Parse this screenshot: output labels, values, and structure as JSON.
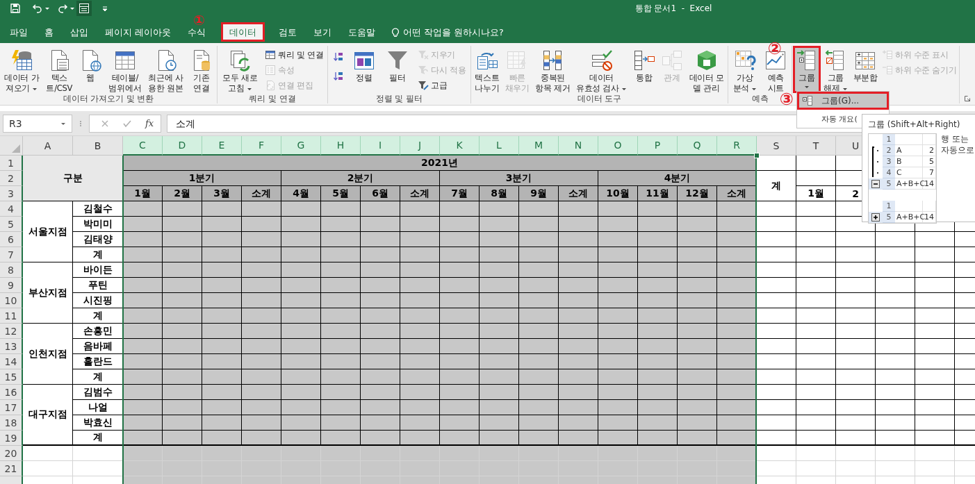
{
  "window": {
    "title": "통합 문서1  -  Excel"
  },
  "tabs": [
    {
      "label": "파일",
      "selected": false,
      "highlighted": false
    },
    {
      "label": "홈",
      "selected": false,
      "highlighted": false
    },
    {
      "label": "삽입",
      "selected": false,
      "highlighted": false
    },
    {
      "label": "페이지 레이아웃",
      "selected": false,
      "highlighted": false
    },
    {
      "label": "수식",
      "selected": false,
      "highlighted": false
    },
    {
      "label": "데이터",
      "selected": true,
      "highlighted": true
    },
    {
      "label": "검토",
      "selected": false,
      "highlighted": false
    },
    {
      "label": "보기",
      "selected": false,
      "highlighted": false
    },
    {
      "label": "도움말",
      "selected": false,
      "highlighted": false
    }
  ],
  "tell_me": "어떤 작업을 원하시나요?",
  "ribbon": [
    {
      "label": "데이터 가져오기 및 변환",
      "items": [
        {
          "kind": "large",
          "label": "데이터 가\n져오기",
          "dropdown": true,
          "disabled": false,
          "pressed": false,
          "highlighted": false
        },
        {
          "kind": "large",
          "label": "텍스\n트/CSV",
          "dropdown": false,
          "disabled": false,
          "pressed": false,
          "highlighted": false
        },
        {
          "kind": "large",
          "label": "웹",
          "dropdown": false,
          "disabled": false,
          "pressed": false,
          "highlighted": false
        },
        {
          "kind": "large",
          "label": "테이블/\n범위에서",
          "dropdown": false,
          "disabled": false,
          "pressed": false,
          "highlighted": false
        },
        {
          "kind": "large",
          "label": "최근에 사\n용한 원본",
          "dropdown": false,
          "disabled": false,
          "pressed": false,
          "highlighted": false
        },
        {
          "kind": "large",
          "label": "기존\n연결",
          "dropdown": false,
          "disabled": false,
          "pressed": false,
          "highlighted": false
        }
      ]
    },
    {
      "label": "쿼리 및 연결",
      "items": [
        {
          "kind": "large",
          "label": "모두 새로\n고침",
          "dropdown": true,
          "disabled": false,
          "pressed": false,
          "highlighted": false
        },
        {
          "kind": "stack",
          "items": [
            {
              "label": "쿼리 및 연결",
              "disabled": false
            },
            {
              "label": "속성",
              "disabled": true
            },
            {
              "label": "연결 편집",
              "disabled": true
            }
          ]
        }
      ]
    },
    {
      "label": "정렬 및 필터",
      "items": [
        {
          "kind": "stack",
          "items": [
            {
              "disabled": false
            },
            {
              "disabled": false
            }
          ]
        },
        {
          "kind": "large",
          "label": "정렬",
          "dropdown": false,
          "disabled": false,
          "pressed": false,
          "highlighted": false
        },
        {
          "kind": "large",
          "label": "필터",
          "dropdown": false,
          "disabled": false,
          "pressed": false,
          "highlighted": false
        },
        {
          "kind": "stack",
          "items": [
            {
              "label": "지우기",
              "disabled": true
            },
            {
              "label": "다시 적용",
              "disabled": true
            },
            {
              "label": "고급",
              "disabled": false
            }
          ]
        }
      ]
    },
    {
      "label": "데이터 도구",
      "items": [
        {
          "kind": "large",
          "label": "텍스트\n나누기",
          "dropdown": false,
          "disabled": false,
          "pressed": false,
          "highlighted": false
        },
        {
          "kind": "large",
          "label": "빠른\n채우기",
          "dropdown": false,
          "disabled": true,
          "pressed": false,
          "highlighted": false
        },
        {
          "kind": "large",
          "label": "중복된\n항목 제거",
          "dropdown": false,
          "disabled": false,
          "pressed": false,
          "highlighted": false
        },
        {
          "kind": "large",
          "label": "데이터\n유효성 검사",
          "dropdown": true,
          "disabled": false,
          "pressed": false,
          "highlighted": false
        },
        {
          "kind": "large",
          "label": "통합",
          "dropdown": false,
          "disabled": false,
          "pressed": false,
          "highlighted": false
        },
        {
          "kind": "large",
          "label": "관계",
          "dropdown": false,
          "disabled": true,
          "pressed": false,
          "highlighted": false
        },
        {
          "kind": "large",
          "label": "데이터 모\n델 관리",
          "dropdown": false,
          "disabled": false,
          "pressed": false,
          "highlighted": false
        }
      ]
    },
    {
      "label": "예측",
      "items": [
        {
          "kind": "large",
          "label": "가상\n분석",
          "dropdown": true,
          "disabled": false,
          "pressed": false,
          "highlighted": false
        },
        {
          "kind": "large",
          "label": "예측\n시트",
          "dropdown": false,
          "disabled": false,
          "pressed": false,
          "highlighted": false
        }
      ]
    },
    {
      "items": [
        {
          "kind": "large",
          "label": "그룹",
          "dropdown": true,
          "disabled": false,
          "pressed": true,
          "highlighted": true
        },
        {
          "kind": "large",
          "label": "그룹\n해제",
          "dropdown": true,
          "disabled": false,
          "pressed": false,
          "highlighted": false
        },
        {
          "kind": "large",
          "label": "부분합",
          "dropdown": false,
          "disabled": false,
          "pressed": false,
          "highlighted": false
        },
        {
          "kind": "stack",
          "items": [
            {
              "label": "하위 수준 표시",
              "disabled": true
            },
            {
              "label": "하위 수준 숨기기",
              "disabled": true
            }
          ]
        }
      ]
    }
  ],
  "menu": [
    {
      "label": "그룹(G)...",
      "selected": true,
      "highlighted": true
    },
    {
      "label": "자동 개요(",
      "selected": false,
      "highlighted": false
    }
  ],
  "tooltip": {
    "title": "그룹 (Shift+Alt+Right)",
    "examples": [
      {
        "expanded": true,
        "rows": [
          {
            "row": "1"
          },
          {
            "row": "2",
            "label": "A",
            "value": "2"
          },
          {
            "row": "3",
            "label": "B",
            "value": "5"
          },
          {
            "row": "4",
            "label": "C",
            "value": "7"
          },
          {
            "row": "5",
            "label": "A+B+C",
            "value": "14"
          }
        ]
      },
      {
        "expanded": false,
        "rows": [
          {
            "row": "1"
          },
          {
            "row": "5",
            "label": "A+B+C",
            "value": "14"
          }
        ]
      }
    ],
    "description": [
      "행 또는",
      "자동으로"
    ]
  },
  "annotations": [
    {
      "label": "①"
    },
    {
      "label": "②"
    },
    {
      "label": "③"
    }
  ],
  "formula_bar": {
    "name_box": "R3",
    "function_label": "fx",
    "value": "소계"
  },
  "sheet": {
    "columns": [
      {
        "label": "A",
        "selected": false
      },
      {
        "label": "B",
        "selected": false
      },
      {
        "label": "C",
        "selected": true
      },
      {
        "label": "D",
        "selected": true
      },
      {
        "label": "E",
        "selected": true
      },
      {
        "label": "F",
        "selected": true
      },
      {
        "label": "G",
        "selected": true
      },
      {
        "label": "H",
        "selected": true
      },
      {
        "label": "I",
        "selected": true
      },
      {
        "label": "J",
        "selected": true
      },
      {
        "label": "K",
        "selected": true
      },
      {
        "label": "L",
        "selected": true
      },
      {
        "label": "M",
        "selected": true
      },
      {
        "label": "N",
        "selected": true
      },
      {
        "label": "O",
        "selected": true
      },
      {
        "label": "P",
        "selected": true
      },
      {
        "label": "Q",
        "selected": true
      },
      {
        "label": "R",
        "selected": true
      },
      {
        "label": "S",
        "selected": false
      },
      {
        "label": "T",
        "selected": false
      },
      {
        "label": "U",
        "selected": false
      }
    ],
    "rows": [
      "1",
      "2",
      "3",
      "4",
      "5",
      "6",
      "7",
      "8",
      "9",
      "10",
      "11",
      "12",
      "13",
      "14",
      "15",
      "16",
      "17",
      "18",
      "19",
      "20",
      "21"
    ],
    "corner_label": "구분",
    "year": "2021년",
    "quarters": [
      {
        "label": "1분기",
        "months": [
          "1월",
          "2월",
          "3월",
          "소계"
        ]
      },
      {
        "label": "2분기",
        "months": [
          "4월",
          "5월",
          "6월",
          "소계"
        ]
      },
      {
        "label": "3분기",
        "months": [
          "7월",
          "8월",
          "9월",
          "소계"
        ]
      },
      {
        "label": "4분기",
        "months": [
          "10월",
          "11월",
          "12월",
          "소계"
        ]
      }
    ],
    "total": "계",
    "next_months": [
      "1월",
      "2"
    ],
    "branches": [
      {
        "name": "서울지점",
        "members": [
          "김철수",
          "박미미",
          "김태양",
          "계"
        ]
      },
      {
        "name": "부산지점",
        "members": [
          "바이든",
          "푸틴",
          "시진핑",
          "계"
        ]
      },
      {
        "name": "인천지점",
        "members": [
          "손흥민",
          "음바페",
          "홀란드",
          "계"
        ]
      },
      {
        "name": "대구지점",
        "members": [
          "김범수",
          "나얼",
          "박효신",
          "계"
        ]
      }
    ]
  }
}
